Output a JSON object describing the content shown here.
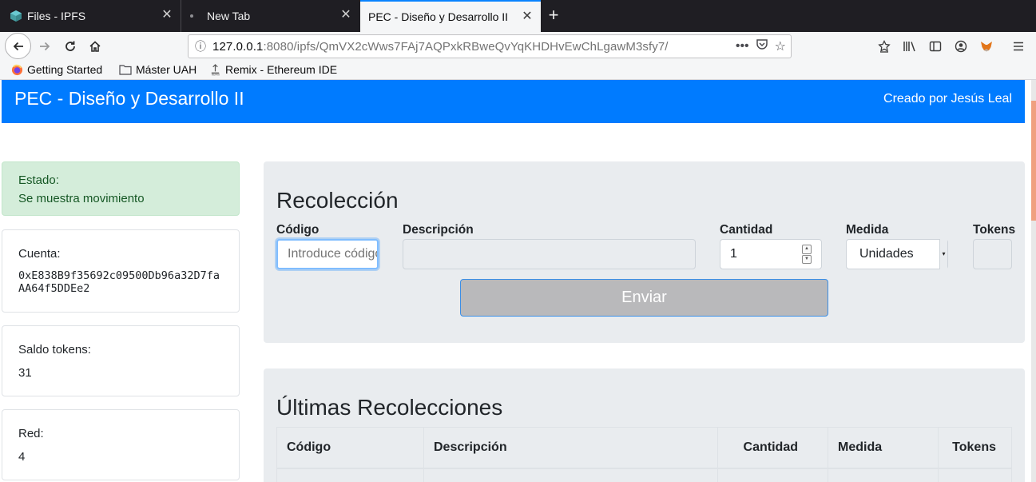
{
  "browser": {
    "tabs": [
      {
        "title": "Files - IPFS",
        "active": false
      },
      {
        "title": "New Tab",
        "active": false
      },
      {
        "title": "PEC - Diseño y Desarrollo II",
        "active": true
      }
    ],
    "url": {
      "host": "127.0.0.1",
      "rest": ":8080/ipfs/QmVX2cWws7FAj7AQPxkRBweQvYqKHDHvEwChLgawM3sfy7/"
    },
    "bookmarks": [
      {
        "label": "Getting Started",
        "icon": "firefox-icon"
      },
      {
        "label": "Máster UAH",
        "icon": "folder-icon"
      },
      {
        "label": "Remix - Ethereum IDE",
        "icon": "remix-icon"
      }
    ]
  },
  "app": {
    "title": "PEC - Diseño y Desarrollo II",
    "author": "Creado por Jesús Leal",
    "accent_color": "#007bff"
  },
  "sidebar": {
    "status": {
      "label": "Estado:",
      "value": "Se muestra movimiento"
    },
    "account": {
      "label": "Cuenta:",
      "value": "0xE838B9f35692c09500Db96a32D7faAA64f5DDEe2"
    },
    "balance": {
      "label": "Saldo tokens:",
      "value": "31"
    },
    "network": {
      "label": "Red:",
      "value": "4"
    }
  },
  "form": {
    "title": "Recolección",
    "fields": {
      "code": {
        "label": "Código",
        "placeholder": "Introduce código"
      },
      "description": {
        "label": "Descripción",
        "value": ""
      },
      "quantity": {
        "label": "Cantidad",
        "value": "1"
      },
      "unit": {
        "label": "Medida",
        "value": "Unidades"
      },
      "tokens": {
        "label": "Tokens",
        "value": ""
      }
    },
    "submit_label": "Enviar"
  },
  "history": {
    "title": "Últimas Recolecciones",
    "columns": [
      "Código",
      "Descripción",
      "Cantidad",
      "Medida",
      "Tokens"
    ]
  }
}
